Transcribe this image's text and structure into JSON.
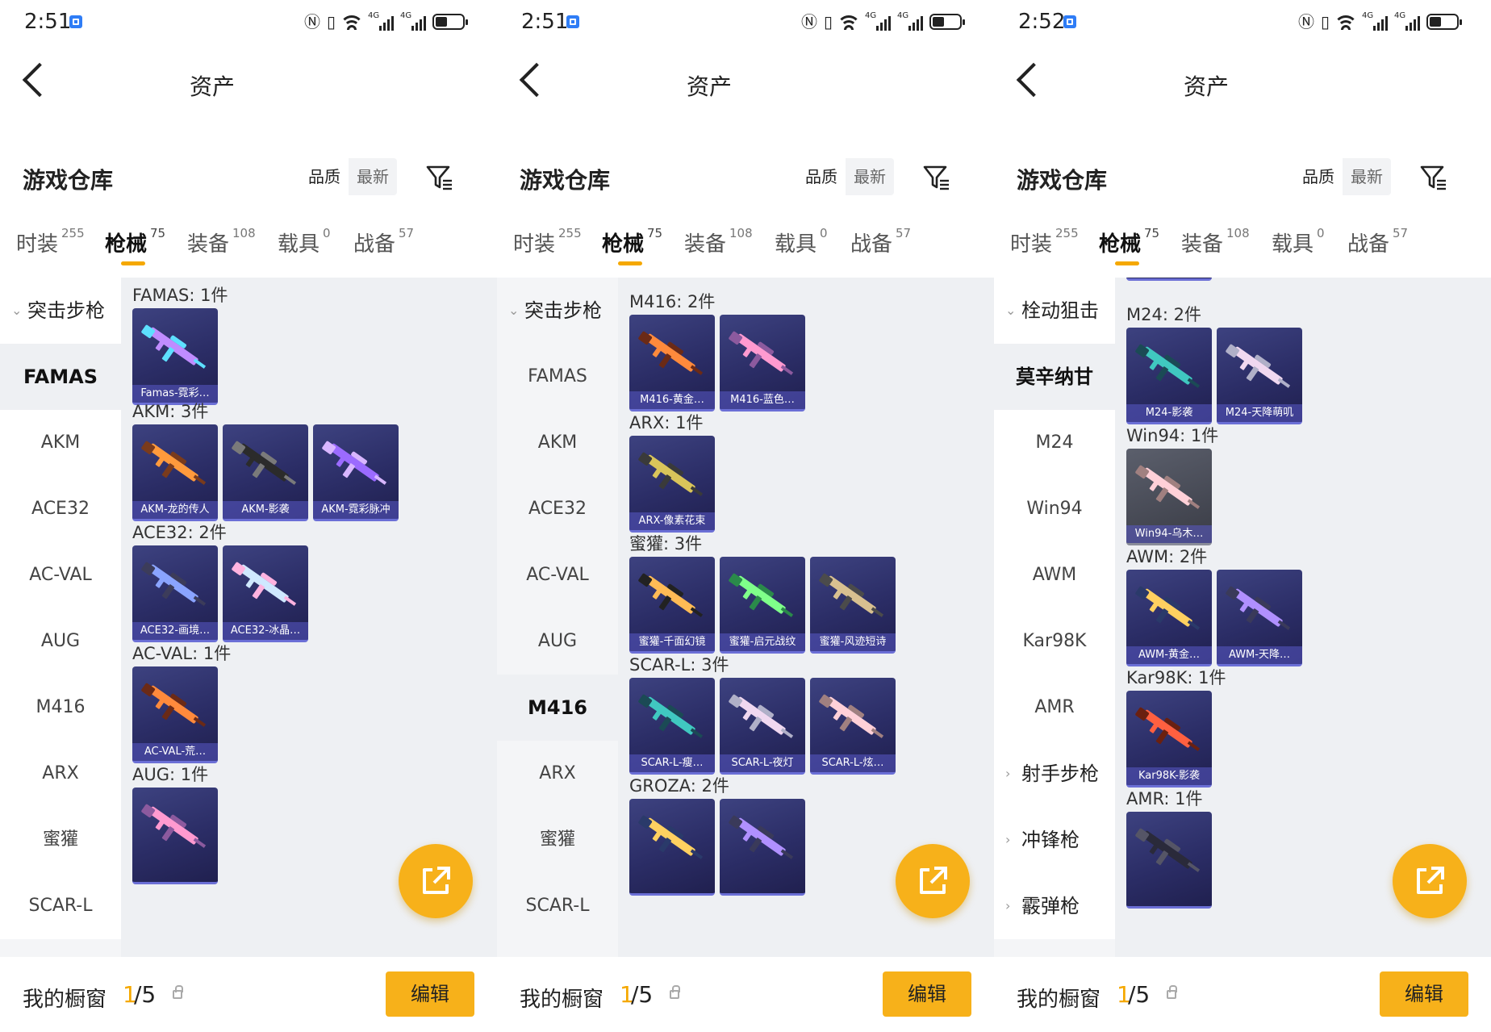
{
  "colors": {
    "accent": "#f5a800",
    "card_bg": "#2b2d66",
    "panel_bg": "#eef0f3"
  },
  "header": {
    "title": "资产"
  },
  "warehouse": {
    "title": "游戏仓库",
    "sort_quality": "品质",
    "sort_latest": "最新"
  },
  "tabs": [
    {
      "label": "时装",
      "count": "255"
    },
    {
      "label": "枪械",
      "count": "75"
    },
    {
      "label": "装备",
      "count": "108"
    },
    {
      "label": "载具",
      "count": "0"
    },
    {
      "label": "战备",
      "count": "57"
    }
  ],
  "bottom": {
    "label": "我的橱窗",
    "current": "1",
    "total": "/5",
    "edit": "编辑"
  },
  "screens": [
    {
      "time": "2:51",
      "sidebar": [
        {
          "label": "突击步枪",
          "kind": "group"
        },
        {
          "label": "FAMAS",
          "kind": "selected"
        },
        {
          "label": "AKM",
          "kind": "item"
        },
        {
          "label": "ACE32",
          "kind": "item"
        },
        {
          "label": "AC-VAL",
          "kind": "item"
        },
        {
          "label": "AUG",
          "kind": "item"
        },
        {
          "label": "M416",
          "kind": "item"
        },
        {
          "label": "ARX",
          "kind": "item"
        },
        {
          "label": "蜜獾",
          "kind": "item"
        },
        {
          "label": "SCAR-L",
          "kind": "item"
        }
      ],
      "sections": [
        {
          "title": "FAMAS: 1件",
          "items": [
            "Famas-霓彩…"
          ]
        },
        {
          "title": "AKM: 3件",
          "items": [
            "AKM-龙的传人",
            "AKM-影袭",
            "AKM-霓彩脉冲"
          ]
        },
        {
          "title": "ACE32: 2件",
          "items": [
            "ACE32-画境…",
            "ACE32-冰晶…"
          ]
        },
        {
          "title": "AC-VAL: 1件",
          "items": [
            "AC-VAL-荒…"
          ]
        },
        {
          "title": "AUG: 1件",
          "items": [
            ""
          ]
        }
      ]
    },
    {
      "time": "2:51",
      "sidebar": [
        {
          "label": "突击步枪",
          "kind": "group"
        },
        {
          "label": "FAMAS",
          "kind": "item"
        },
        {
          "label": "AKM",
          "kind": "item"
        },
        {
          "label": "ACE32",
          "kind": "item"
        },
        {
          "label": "AC-VAL",
          "kind": "item"
        },
        {
          "label": "AUG",
          "kind": "item"
        },
        {
          "label": "M416",
          "kind": "selected"
        },
        {
          "label": "ARX",
          "kind": "item"
        },
        {
          "label": "蜜獾",
          "kind": "item"
        },
        {
          "label": "SCAR-L",
          "kind": "item"
        }
      ],
      "sections": [
        {
          "title": "M416: 2件",
          "items": [
            "M416-黄金…",
            "M416-蓝色…"
          ]
        },
        {
          "title": "ARX: 1件",
          "items": [
            "ARX-像素花束"
          ]
        },
        {
          "title": "蜜獾: 3件",
          "items": [
            "蜜獾-千面幻镜",
            "蜜獾-启元战纹",
            "蜜獾-风迹短诗"
          ]
        },
        {
          "title": "SCAR-L: 3件",
          "items": [
            "SCAR-L-瘦…",
            "SCAR-L-夜灯",
            "SCAR-L-炫…"
          ]
        },
        {
          "title": "GROZA: 2件",
          "items": [
            "",
            ""
          ]
        }
      ]
    },
    {
      "time": "2:52",
      "sidebar": [
        {
          "label": "栓动狙击",
          "kind": "group"
        },
        {
          "label": "莫辛纳甘",
          "kind": "selected"
        },
        {
          "label": "M24",
          "kind": "item"
        },
        {
          "label": "Win94",
          "kind": "item"
        },
        {
          "label": "AWM",
          "kind": "item"
        },
        {
          "label": "Kar98K",
          "kind": "item"
        },
        {
          "label": "AMR",
          "kind": "item"
        },
        {
          "label": "射手步枪",
          "kind": "group-collapsed"
        },
        {
          "label": "冲锋枪",
          "kind": "group-collapsed"
        },
        {
          "label": "霰弹枪",
          "kind": "group-collapsed"
        }
      ],
      "sections": [
        {
          "title": "M24: 2件",
          "items": [
            "M24-影袭",
            "M24-天降萌叽"
          ]
        },
        {
          "title": "Win94: 1件",
          "items": [
            "Win94-乌木…"
          ],
          "grey": true
        },
        {
          "title": "AWM: 2件",
          "items": [
            "AWM-黄金…",
            "AWM-天降…"
          ]
        },
        {
          "title": "Kar98K: 1件",
          "items": [
            "Kar98K-影袭"
          ]
        },
        {
          "title": "AMR: 1件",
          "items": [
            ""
          ]
        }
      ]
    }
  ]
}
